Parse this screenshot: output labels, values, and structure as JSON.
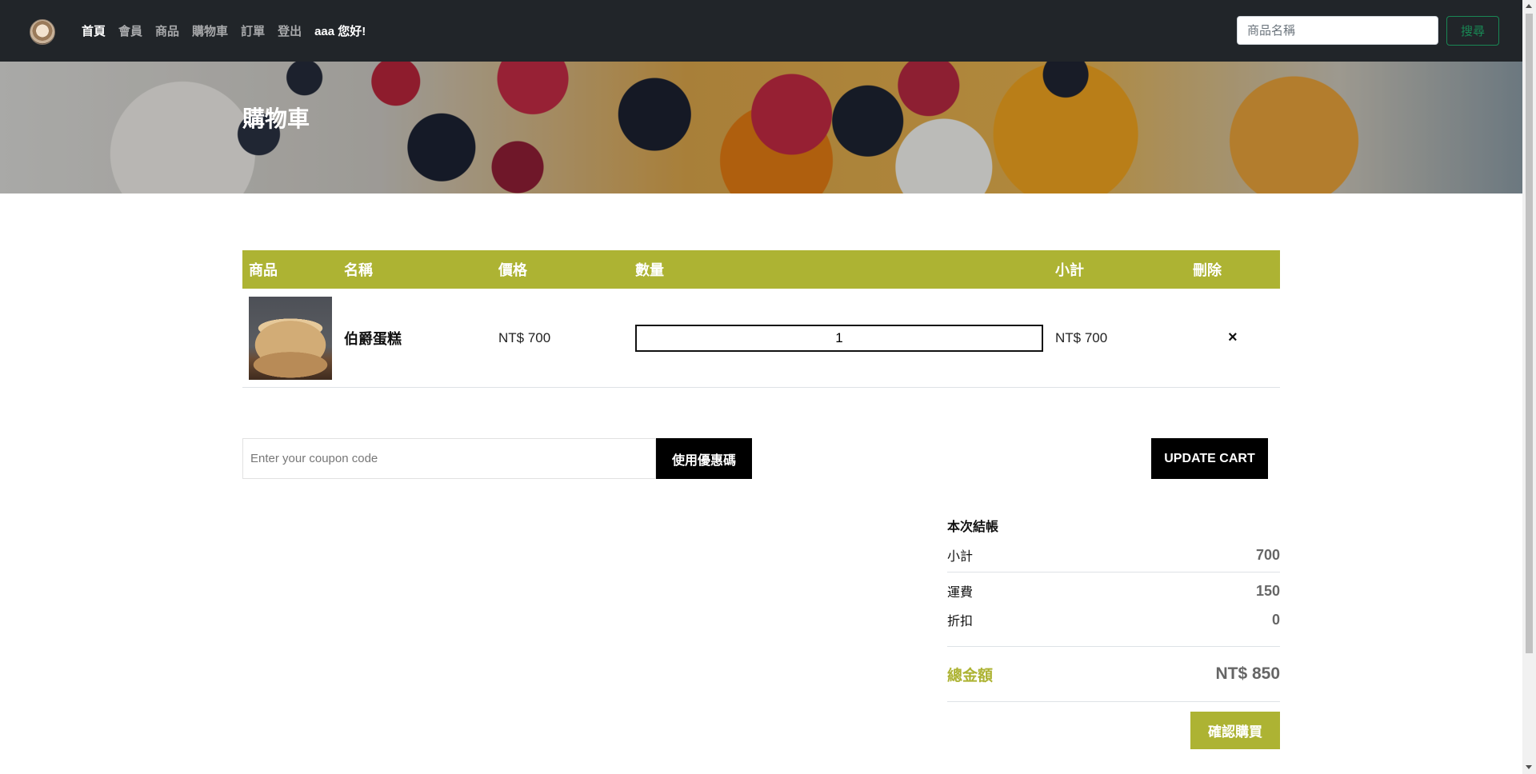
{
  "nav": {
    "links": [
      {
        "label": "首頁",
        "active": true
      },
      {
        "label": "會員",
        "active": false
      },
      {
        "label": "商品",
        "active": false
      },
      {
        "label": "購物車",
        "active": false
      },
      {
        "label": "訂單",
        "active": false
      },
      {
        "label": "登出",
        "active": false
      }
    ],
    "greeting": "aaa 您好!",
    "search_placeholder": "商品名稱",
    "search_button": "搜尋"
  },
  "hero": {
    "title": "購物車"
  },
  "cart": {
    "headers": [
      "商品",
      "名稱",
      "價格",
      "數量",
      "小計",
      "刪除"
    ],
    "items": [
      {
        "name": "伯爵蛋糕",
        "price": "NT$ 700",
        "quantity": "1",
        "subtotal": "NT$ 700",
        "remove": "×"
      }
    ]
  },
  "coupon": {
    "placeholder": "Enter your coupon code",
    "apply_button": "使用優惠碼",
    "update_button": "UPDATE CART"
  },
  "summary": {
    "title": "本次結帳",
    "subtotal_label": "小計",
    "subtotal_value": "700",
    "shipping_label": "運費",
    "shipping_value": "150",
    "discount_label": "折扣",
    "discount_value": "0",
    "total_label": "總金額",
    "total_value": "NT$ 850",
    "confirm_button": "確認購買"
  },
  "colors": {
    "navbar": "#212529",
    "accent_olive": "#adb333",
    "search_green": "#198754",
    "button_black": "#000000"
  }
}
